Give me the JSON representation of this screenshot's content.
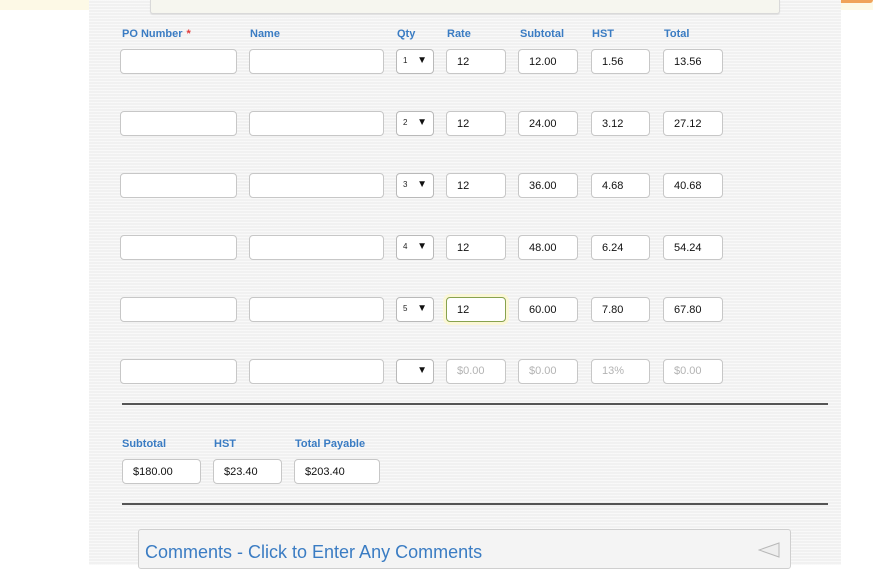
{
  "headers": {
    "po_number": "PO Number",
    "required_mark": "*",
    "name": "Name",
    "qty": "Qty",
    "rate": "Rate",
    "subtotal": "Subtotal",
    "hst": "HST",
    "total": "Total"
  },
  "rows": [
    {
      "po": "",
      "name": "",
      "qty": "1",
      "rate": "12",
      "subtotal": "12.00",
      "hst": "1.56",
      "total": "13.56"
    },
    {
      "po": "",
      "name": "",
      "qty": "2",
      "rate": "12",
      "subtotal": "24.00",
      "hst": "3.12",
      "total": "27.12"
    },
    {
      "po": "",
      "name": "",
      "qty": "3",
      "rate": "12",
      "subtotal": "36.00",
      "hst": "4.68",
      "total": "40.68"
    },
    {
      "po": "",
      "name": "",
      "qty": "4",
      "rate": "12",
      "subtotal": "48.00",
      "hst": "6.24",
      "total": "54.24"
    },
    {
      "po": "",
      "name": "",
      "qty": "5",
      "rate": "12",
      "subtotal": "60.00",
      "hst": "7.80",
      "total": "67.80"
    }
  ],
  "empty_row": {
    "rate_placeholder": "$0.00",
    "subtotal_placeholder": "$0.00",
    "hst_placeholder": "13%",
    "total_placeholder": "$0.00"
  },
  "totals": {
    "subtotal_label": "Subtotal",
    "subtotal_value": "$180.00",
    "hst_label": "HST",
    "hst_value": "$23.40",
    "total_label": "Total Payable",
    "total_value": "$203.40"
  },
  "comments": {
    "label": "Comments - Click to Enter Any Comments",
    "toggle_icon": "triangle-left-icon"
  },
  "colors": {
    "label_blue": "#3a7cc3",
    "required_red": "#e23b3b",
    "focus_border": "#87a24e"
  }
}
